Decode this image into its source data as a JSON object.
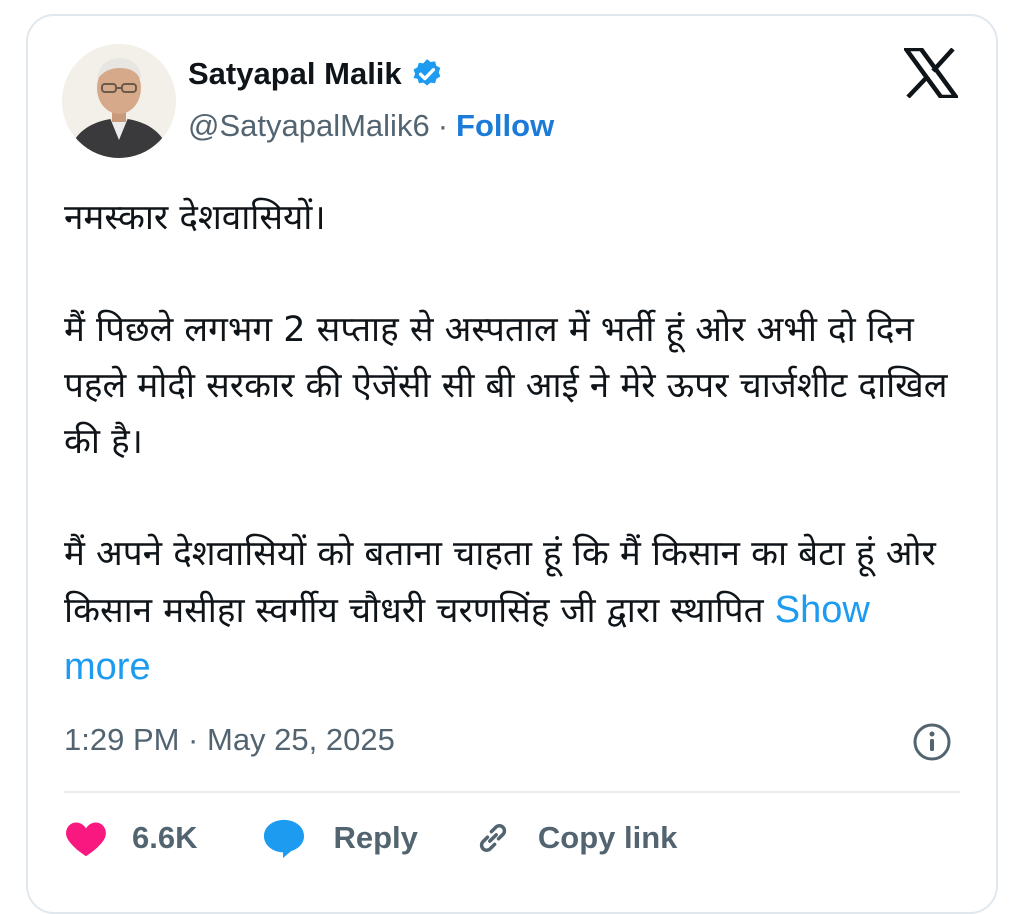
{
  "author": {
    "name": "Satyapal Malik",
    "handle": "@SatyapalMalik6",
    "separator": "·",
    "follow_label": "Follow",
    "avatar_icon": "avatar-photo",
    "verified_icon": "verified-badge-icon",
    "verified_color": "#1d9bf0"
  },
  "platform": {
    "logo_icon": "x-logo-icon"
  },
  "tweet": {
    "paragraphs": [
      "नमस्कार देशवासियों।",
      "मैं पिछले लगभग 2 सप्ताह से अस्पताल में भर्ती हूं ओर अभी दो दिन पहले मोदी सरकार की ऐजेंसी सी  बी आई ने मेरे ऊपर चार्जशीट दाखिल की है।",
      "मैं अपने देशवासियों को बताना चाहता हूं कि मैं किसान का बेटा हूं ओर किसान मसीहा स्वर्गीय चौधरी चरणसिंह जी द्वारा स्थापित"
    ],
    "show_more_label": "Show more",
    "timestamp": "1:29 PM · May 25, 2025",
    "info_icon": "info-icon"
  },
  "actions": {
    "like_count": "6.6K",
    "reply_label": "Reply",
    "copy_link_label": "Copy link",
    "like_color": "#f91880",
    "reply_color": "#1d9bf0"
  }
}
